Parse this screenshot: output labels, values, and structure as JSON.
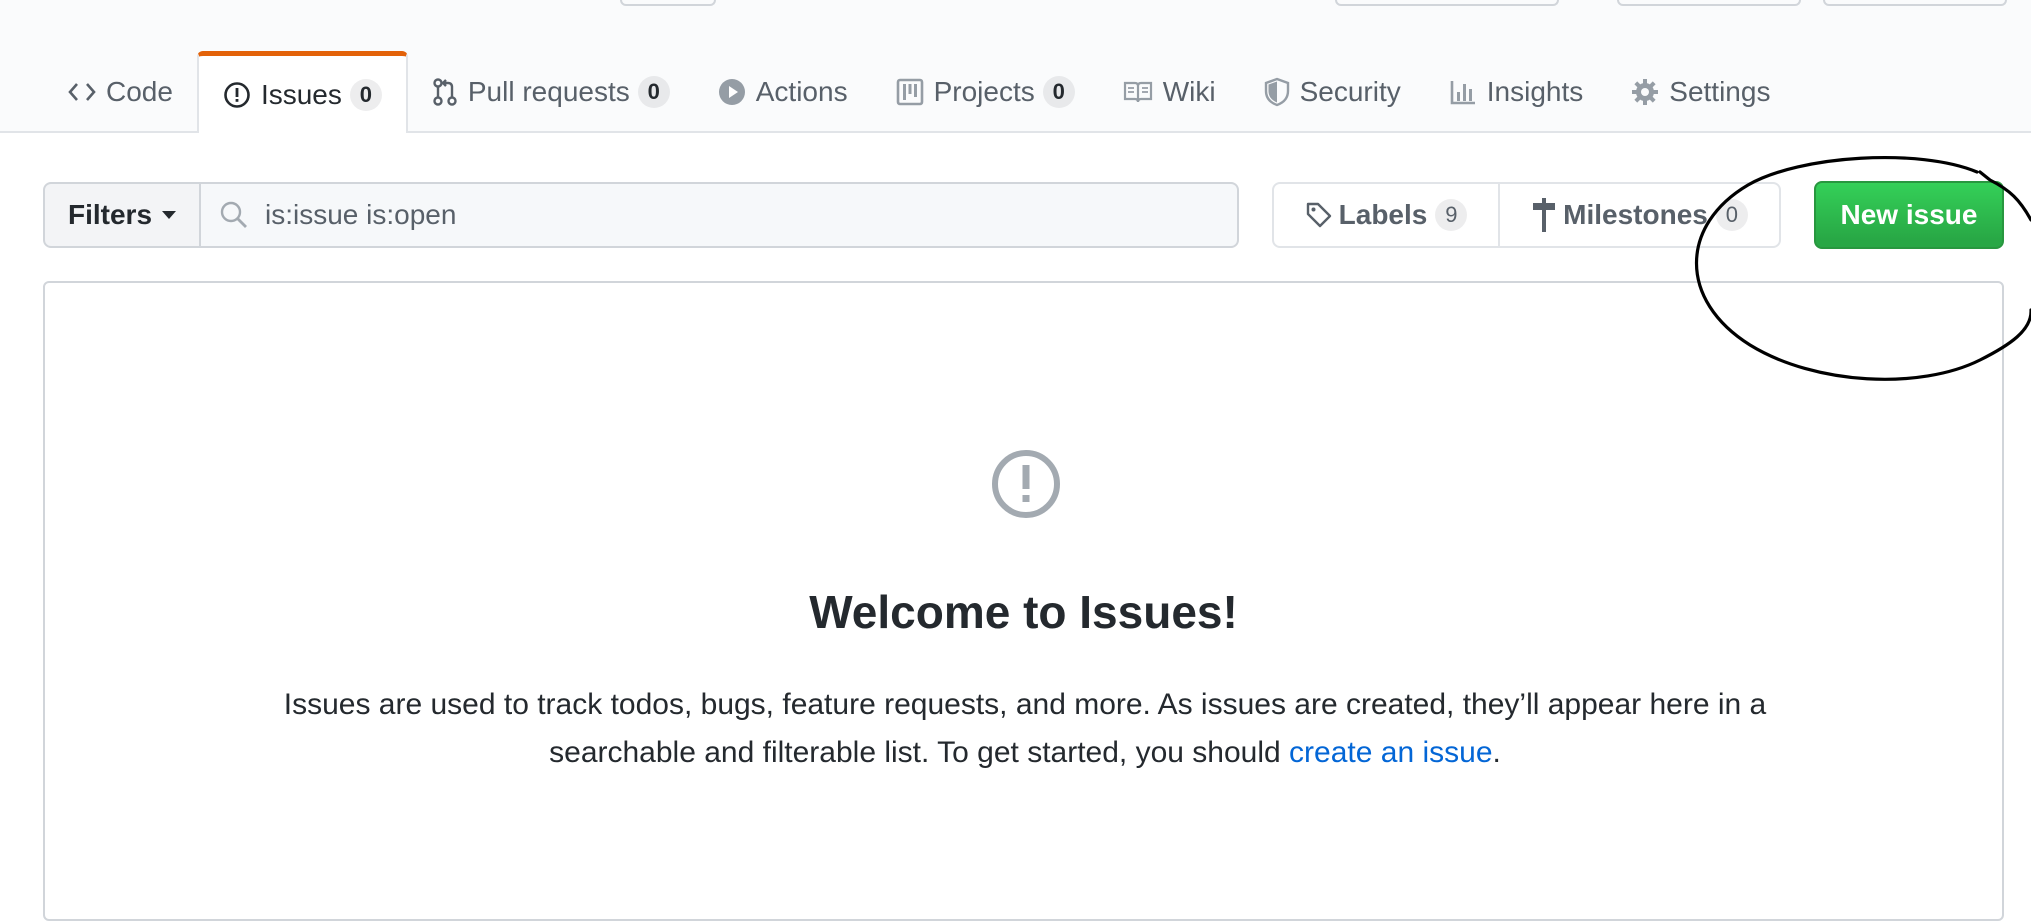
{
  "tabs": [
    {
      "label": "Code",
      "icon": "code-icon"
    },
    {
      "label": "Issues",
      "count": "0",
      "icon": "issue-opened-icon"
    },
    {
      "label": "Pull requests",
      "count": "0",
      "icon": "git-pull-request-icon"
    },
    {
      "label": "Actions",
      "icon": "play-icon"
    },
    {
      "label": "Projects",
      "count": "0",
      "icon": "project-icon"
    },
    {
      "label": "Wiki",
      "icon": "book-icon"
    },
    {
      "label": "Security",
      "icon": "shield-icon"
    },
    {
      "label": "Insights",
      "icon": "graph-icon"
    },
    {
      "label": "Settings",
      "icon": "gear-icon"
    }
  ],
  "selected_tab": "Issues",
  "accent_colors": {
    "selected_tab_border": "#e36209",
    "new_issue_bg": "#2ea44f",
    "link": "#0366d6"
  },
  "subnav": {
    "filters_label": "Filters",
    "search_value": "is:issue is:open",
    "labels_label": "Labels",
    "labels_count": "9",
    "milestones_label": "Milestones",
    "milestones_count": "0",
    "new_issue_label": "New issue"
  },
  "blankslate": {
    "title": "Welcome to Issues!",
    "description_before_link": "Issues are used to track todos, bugs, feature requests, and more. As issues are created, they’ll appear here in a searchable and filterable list. To get started, you should ",
    "link_text": "create an issue",
    "description_after_link": "."
  },
  "annotation": {
    "shape": "hand-drawn circle around New issue button",
    "color": "#000000"
  }
}
